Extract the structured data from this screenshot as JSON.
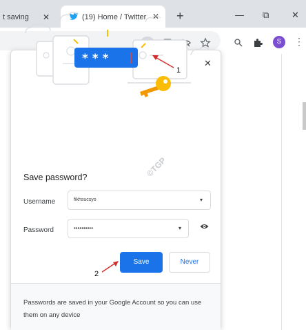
{
  "browser": {
    "inactive_tab_title": "t saving",
    "active_tab_title": "(19) Home / Twitter",
    "tab_close_glyph": "✕",
    "new_tab_glyph": "+",
    "minimize_glyph": "—",
    "restore_glyph": "⧉",
    "window_close_glyph": "✕",
    "profile_initial": "S",
    "kebab_glyph": "⋮",
    "colors": {
      "tabstrip": "#dee1e6",
      "accent": "#1a73e8",
      "twitter": "#1da1f2",
      "avatar": "#7b4dd1"
    }
  },
  "toolbar_icons": [
    "key-icon",
    "install-icon",
    "eye-off-icon",
    "star-icon",
    "search-icon",
    "puzzle-icon"
  ],
  "dialog": {
    "close_glyph": "✕",
    "title": "Save password?",
    "username_label": "Username",
    "username_value": "fikhsucsyo",
    "password_label": "Password",
    "password_value": "••••••••••",
    "dropdown_glyph": "▾",
    "save_label": "Save",
    "never_label": "Never",
    "footer": "Passwords are saved in your Google Account so you can use them on any device",
    "illustration_text": "* * *"
  },
  "annotations": {
    "label_1": "1",
    "label_2": "2",
    "watermark": "©TGP"
  }
}
